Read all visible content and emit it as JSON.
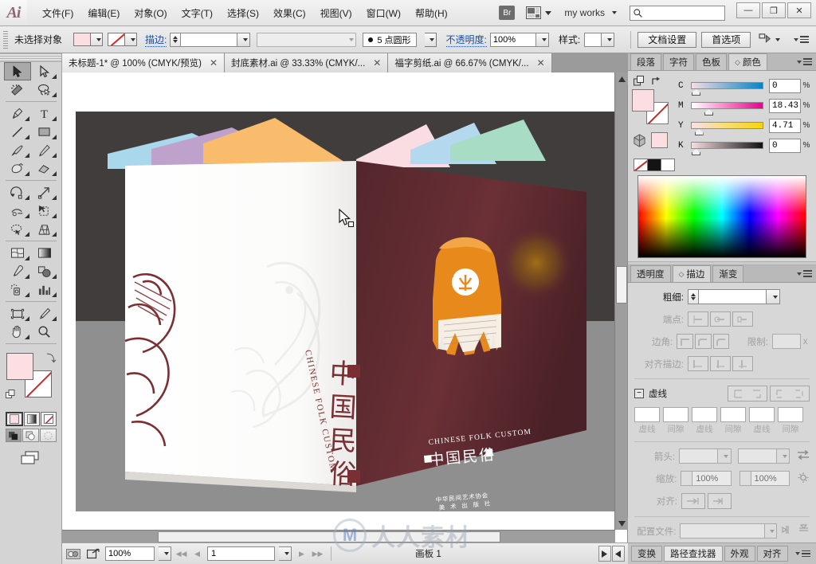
{
  "app": {
    "name": "Ai",
    "logo_text": "Ai"
  },
  "menubar": {
    "items": [
      {
        "label": "文件(F)",
        "name": "menu-file"
      },
      {
        "label": "编辑(E)",
        "name": "menu-edit"
      },
      {
        "label": "对象(O)",
        "name": "menu-object"
      },
      {
        "label": "文字(T)",
        "name": "menu-type"
      },
      {
        "label": "选择(S)",
        "name": "menu-select"
      },
      {
        "label": "效果(C)",
        "name": "menu-effect"
      },
      {
        "label": "视图(V)",
        "name": "menu-view"
      },
      {
        "label": "窗口(W)",
        "name": "menu-window"
      },
      {
        "label": "帮助(H)",
        "name": "menu-help"
      }
    ],
    "bridge_label": "Br",
    "workspace": "my works",
    "search_placeholder": "",
    "search_value": "",
    "window_buttons": {
      "minimize": "—",
      "maximize": "❐",
      "close": "✕"
    }
  },
  "controlbar": {
    "selection_status": "未选择对象",
    "fill_color": "#fbdde2",
    "stroke_none_label": "无",
    "stroke_label": "描边:",
    "stroke_weight_value": "",
    "brush_definition_value": "",
    "profile_label": "5 点圆形",
    "opacity_label": "不透明度:",
    "opacity_value": "100%",
    "style_label": "样式:",
    "doc_setup_label": "文档设置",
    "preferences_label": "首选项",
    "align_label": "",
    "panel_menu_label": ""
  },
  "tabs": [
    {
      "title": "未标题-1* @ 100% (CMYK/预览)",
      "active": true,
      "close": "✕"
    },
    {
      "title": "封底素材.ai @ 33.33% (CMYK/...",
      "active": false,
      "close": "✕"
    },
    {
      "title": "福字剪纸.ai @ 66.67% (CMYK/...",
      "active": false,
      "close": "✕"
    }
  ],
  "toolbox": {
    "tools": [
      {
        "name": "selection-tool",
        "label": "选择工具",
        "selected": true
      },
      {
        "name": "direct-selection-tool",
        "label": "直接选择工具",
        "selected": false
      },
      {
        "name": "magic-wand-tool",
        "label": "魔棒工具",
        "selected": false
      },
      {
        "name": "lasso-tool",
        "label": "套索工具",
        "selected": false
      },
      {
        "name": "pen-tool",
        "label": "钢笔工具",
        "selected": false
      },
      {
        "name": "type-tool",
        "label": "文字工具",
        "selected": false
      },
      {
        "name": "line-segment-tool",
        "label": "直线段工具",
        "selected": false
      },
      {
        "name": "rectangle-tool",
        "label": "矩形工具",
        "selected": false
      },
      {
        "name": "paintbrush-tool",
        "label": "画笔工具",
        "selected": false
      },
      {
        "name": "pencil-tool",
        "label": "铅笔工具",
        "selected": false
      },
      {
        "name": "blob-brush-tool",
        "label": "斑点画笔工具",
        "selected": false
      },
      {
        "name": "eraser-tool",
        "label": "橡皮擦工具",
        "selected": false
      },
      {
        "name": "rotate-tool",
        "label": "旋转工具",
        "selected": false
      },
      {
        "name": "scale-tool",
        "label": "比例缩放工具",
        "selected": false
      },
      {
        "name": "width-tool",
        "label": "宽度工具",
        "selected": false
      },
      {
        "name": "free-transform-tool",
        "label": "自由变换工具",
        "selected": false
      },
      {
        "name": "shape-builder-tool",
        "label": "形状生成器工具",
        "selected": false
      },
      {
        "name": "perspective-grid-tool",
        "label": "透视网格工具",
        "selected": false
      },
      {
        "name": "mesh-tool",
        "label": "网格工具",
        "selected": false
      },
      {
        "name": "gradient-tool",
        "label": "渐变工具",
        "selected": false
      },
      {
        "name": "eyedropper-tool",
        "label": "吸管工具",
        "selected": false
      },
      {
        "name": "blend-tool",
        "label": "混合工具",
        "selected": false
      },
      {
        "name": "symbol-sprayer-tool",
        "label": "符号喷枪工具",
        "selected": false
      },
      {
        "name": "column-graph-tool",
        "label": "柱形图工具",
        "selected": false
      },
      {
        "name": "artboard-tool",
        "label": "画板工具",
        "selected": false
      },
      {
        "name": "slice-tool",
        "label": "切片工具",
        "selected": false
      },
      {
        "name": "hand-tool",
        "label": "抓手工具",
        "selected": false
      },
      {
        "name": "zoom-tool",
        "label": "缩放工具",
        "selected": false
      }
    ],
    "fill_color": "#fbdfe3",
    "stroke_color": "none",
    "color_modes": [
      "color",
      "gradient",
      "none"
    ],
    "draw_modes": [
      "正常绘图",
      "背面绘图",
      "内部绘图"
    ],
    "screen_mode": "更改屏幕模式"
  },
  "artwork": {
    "description": "中国民俗 折页画册立体效果图",
    "cover_title_cn": "中国民俗",
    "cover_title_en": "CHINESE FOLK CUSTOM",
    "back_publisher_line1": "中华民间艺术协会",
    "back_publisher_line2": "美 术 出 版 社",
    "back_bg_color": "#5b2a30",
    "front_bg_color": "#fdfcfa",
    "accent_orange": "#e8891c",
    "page_edge_colors": [
      "#a9d8ec",
      "#bfa2cc",
      "#f8bc6c",
      "#f9dde2",
      "#b4d9ef",
      "#a8dcc4"
    ],
    "canvas_top_color": "#403d3c",
    "canvas_bottom_color": "#8f8f8f"
  },
  "color_panel": {
    "tabs": [
      {
        "label": "段落",
        "active": false
      },
      {
        "label": "字符",
        "active": false
      },
      {
        "label": "色板",
        "active": false
      },
      {
        "label": "颜色",
        "active": true
      }
    ],
    "mode": "CMYK",
    "channels": [
      {
        "label": "C",
        "value": "0",
        "percent": "%",
        "pos": 0.0
      },
      {
        "label": "M",
        "value": "18.43",
        "percent": "%",
        "pos": 0.185
      },
      {
        "label": "Y",
        "value": "4.71",
        "percent": "%",
        "pos": 0.048
      },
      {
        "label": "K",
        "value": "0",
        "percent": "%",
        "pos": 0.0
      }
    ],
    "fill_color": "#fbdde2",
    "stroke_color": "none",
    "quick_swatches": [
      "none",
      "#141414",
      "#ffffff"
    ]
  },
  "stroke_panel": {
    "tabs": [
      {
        "label": "透明度",
        "active": false
      },
      {
        "label": "描边",
        "active": true
      },
      {
        "label": "渐变",
        "active": false
      }
    ],
    "weight_label": "粗细:",
    "weight_value": "",
    "cap_label": "端点:",
    "corner_label": "边角:",
    "limit_label": "限制:",
    "limit_value": "",
    "limit_unit": "x",
    "align_stroke_label": "对齐描边:",
    "dashed_label": "虚线",
    "dash_fields": [
      "",
      "",
      "",
      "",
      "",
      ""
    ],
    "dash_captions": [
      "虚线",
      "间隙",
      "虚线",
      "间隙",
      "虚线",
      "间隙"
    ],
    "arrow_label": "箭头:",
    "arrow_start": "",
    "arrow_end": "",
    "scale_label": "缩放:",
    "scale_start": "100%",
    "scale_end": "100%",
    "align_label": "对齐:",
    "profile_label": "配置文件:",
    "profile_value": ""
  },
  "bottom_panel_tabs": [
    {
      "label": "变换",
      "active": false
    },
    {
      "label": "路径查找器",
      "active": true
    },
    {
      "label": "外观",
      "active": false
    },
    {
      "label": "对齐",
      "active": false
    }
  ],
  "statusbar": {
    "zoom_value": "100%",
    "page_value": "1",
    "artboard_label": "画板 1",
    "first_arrow": "◀◀",
    "prev_arrow": "◀",
    "next_arrow": "▶",
    "last_arrow": "▶▶"
  },
  "watermark": {
    "text": "人人素材",
    "mark": "M"
  }
}
